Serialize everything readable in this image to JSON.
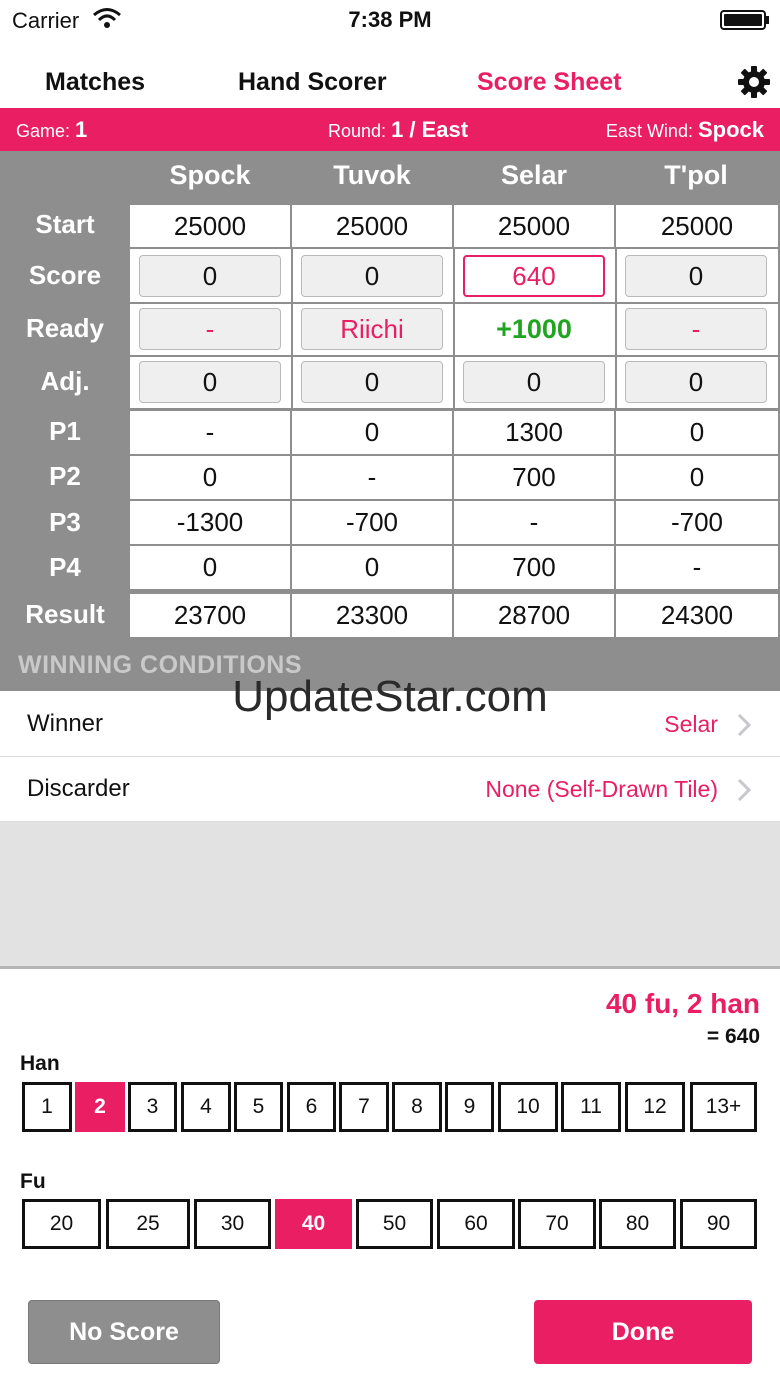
{
  "status": {
    "carrier": "Carrier",
    "time": "7:38 PM"
  },
  "nav": {
    "tabs": [
      "Matches",
      "Hand Scorer",
      "Score Sheet"
    ],
    "active_tab": "Score Sheet"
  },
  "info": {
    "game_label": "Game:",
    "game_value": "1",
    "round_label": "Round:",
    "round_value": "1 / East",
    "wind_label": "East Wind:",
    "wind_value": "Spock"
  },
  "players": [
    "Spock",
    "Tuvok",
    "Selar",
    "T'pol"
  ],
  "row_labels": {
    "start": "Start",
    "score": "Score",
    "ready": "Ready",
    "adj": "Adj.",
    "p1": "P1",
    "p2": "P2",
    "p3": "P3",
    "p4": "P4",
    "result": "Result"
  },
  "table": {
    "start": [
      "25000",
      "25000",
      "25000",
      "25000"
    ],
    "score": [
      "0",
      "0",
      "640",
      "0"
    ],
    "ready": [
      "-",
      "Riichi",
      "+1000",
      "-"
    ],
    "adj": [
      "0",
      "0",
      "0",
      "0"
    ],
    "p1": [
      "-",
      "0",
      "1300",
      "0"
    ],
    "p2": [
      "0",
      "-",
      "700",
      "0"
    ],
    "p3": [
      "-1300",
      "-700",
      "-",
      "-700"
    ],
    "p4": [
      "0",
      "0",
      "700",
      "-"
    ],
    "result": [
      "23700",
      "23300",
      "28700",
      "24300"
    ]
  },
  "section_header": "WINNING CONDITIONS",
  "watermark": "UpdateStar.com",
  "winner": {
    "label": "Winner",
    "value": "Selar"
  },
  "discarder": {
    "label": "Discarder",
    "value": "None (Self-Drawn Tile)"
  },
  "summary": {
    "main": "40 fu, 2 han",
    "points": "= 640"
  },
  "han": {
    "label": "Han",
    "options": [
      "1",
      "2",
      "3",
      "4",
      "5",
      "6",
      "7",
      "8",
      "9",
      "10",
      "11",
      "12",
      "13+"
    ],
    "selected": "2"
  },
  "fu": {
    "label": "Fu",
    "options": [
      "20",
      "25",
      "30",
      "40",
      "50",
      "60",
      "70",
      "80",
      "90"
    ],
    "selected": "40"
  },
  "buttons": {
    "no_score": "No Score",
    "done": "Done"
  },
  "colors": {
    "accent": "#e91e63",
    "panel_gray": "#8e8e8e",
    "ready_bonus_green": "#21a521",
    "no_score_gray": "#8e8e8e"
  }
}
